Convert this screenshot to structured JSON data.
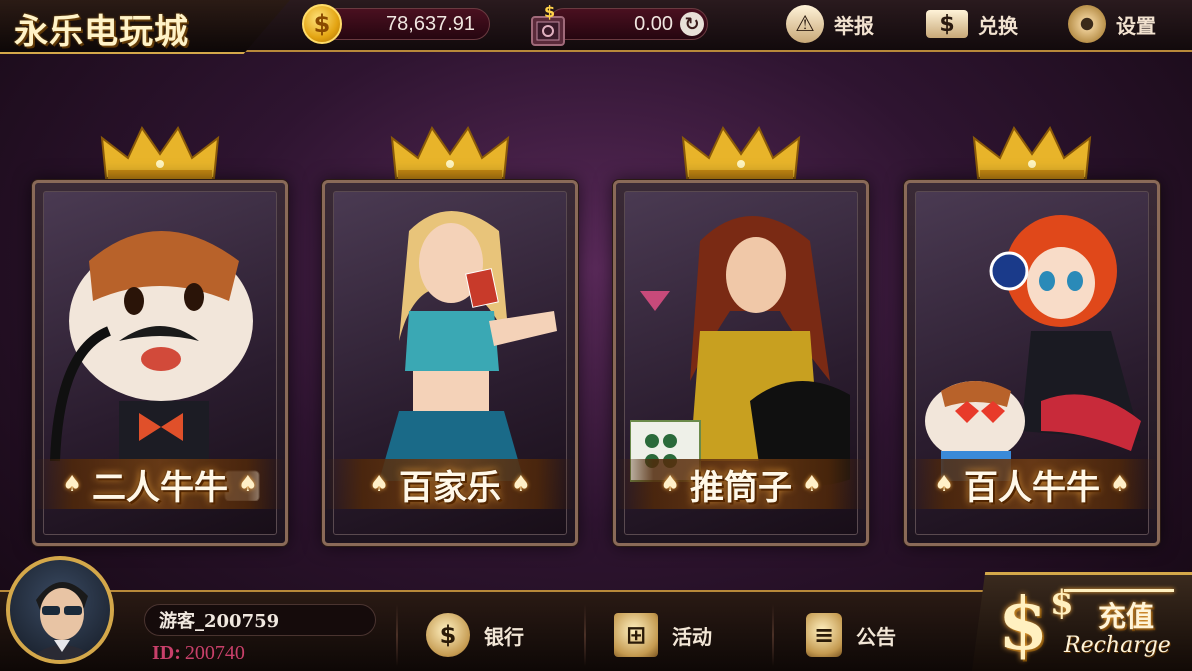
{
  "app": {
    "title": "永乐电玩城"
  },
  "header": {
    "coin_balance": "78,637.91",
    "bank_balance": "0.00",
    "report_label": "举报",
    "exchange_label": "兑换",
    "settings_label": "设置",
    "icons": {
      "coin": "coin-dollar-icon",
      "bank": "bank-safe-icon",
      "refresh": "refresh-icon",
      "report": "warning-icon",
      "exchange": "banknote-icon",
      "settings": "gear-icon"
    }
  },
  "games": [
    {
      "label": "二人牛牛",
      "art": "bull-mascot-art"
    },
    {
      "label": "百家乐",
      "art": "dealer-girl-art"
    },
    {
      "label": "推筒子",
      "art": "mahjong-lady-art"
    },
    {
      "label": "百人牛牛",
      "art": "bull-and-girl-art"
    }
  ],
  "user": {
    "name": "游客_200759",
    "id_label": "ID:",
    "id_value": "200740"
  },
  "footer": {
    "bank_label": "银行",
    "activity_label": "活动",
    "notice_label": "公告",
    "recharge_cn": "充值",
    "recharge_en": "Recharge",
    "recharge_symbol": "$",
    "recharge_symbol_small": "$"
  },
  "colors": {
    "accent_gold": "#d4a84a",
    "background": "#2e1430",
    "id_text": "#c8406a"
  }
}
